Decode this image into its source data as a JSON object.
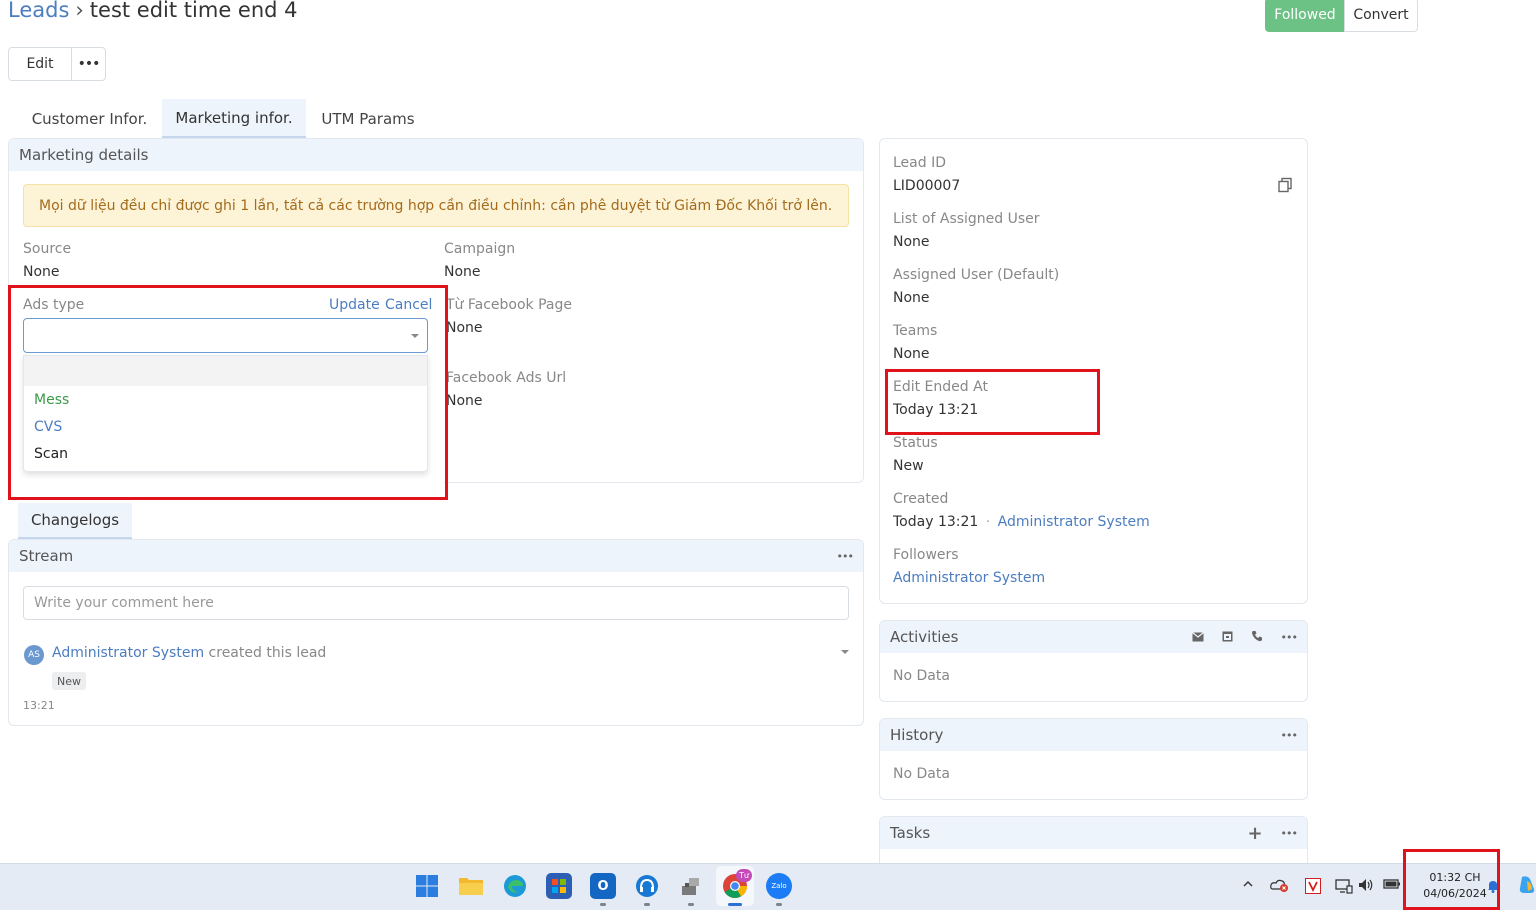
{
  "header": {
    "breadcrumb_root": "Leads",
    "breadcrumb_sep": "›",
    "title": "test edit time end 4",
    "edit_label": "Edit",
    "more_label": "•••",
    "followed_label": "Followed",
    "convert_label": "Convert"
  },
  "tabs": [
    {
      "label": "Customer Infor."
    },
    {
      "label": "Marketing infor."
    },
    {
      "label": "UTM Params"
    }
  ],
  "marketing": {
    "panel_title": "Marketing details",
    "alert": "Mọi dữ liệu đều chỉ được ghi 1 lần, tất cả các trường hợp cần điều chỉnh: cần phê duyệt từ Giám Đốc Khối trở lên.",
    "source_label": "Source",
    "source_value": "None",
    "campaign_label": "Campaign",
    "campaign_value": "None",
    "ads_type_label": "Ads type",
    "update_label": "Update",
    "cancel_label": "Cancel",
    "fb_page_label": "Từ Facebook Page",
    "fb_page_value": "None",
    "fb_ads_url_label": "Facebook Ads Url",
    "fb_ads_url_value": "None",
    "ads_type_options": [
      {
        "label": "Mess",
        "color": "#3b9b4a"
      },
      {
        "label": "CVS",
        "color": "#4c7dc0"
      },
      {
        "label": "Scan",
        "color": "#222222"
      }
    ]
  },
  "changelogs": {
    "tab_label": "Changelogs",
    "stream_title": "Stream",
    "comment_placeholder": "Write your comment here",
    "entry_avatar": "AS",
    "entry_user": "Administrator System",
    "entry_action": "created this lead",
    "entry_badge": "New",
    "entry_time": "13:21"
  },
  "side": {
    "lead_id_label": "Lead ID",
    "lead_id_value": "LID00007",
    "assigned_list_label": "List of Assigned User",
    "assigned_list_value": "None",
    "assigned_default_label": "Assigned User (Default)",
    "assigned_default_value": "None",
    "teams_label": "Teams",
    "teams_value": "None",
    "edit_ended_label": "Edit Ended At",
    "edit_ended_value": "Today 13:21",
    "status_label": "Status",
    "status_value": "New",
    "created_label": "Created",
    "created_value": "Today 13:21",
    "created_dot": "·",
    "created_by": "Administrator System",
    "followers_label": "Followers",
    "followers_value": "Administrator System"
  },
  "activities": {
    "title": "Activities",
    "empty": "No Data"
  },
  "history": {
    "title": "History",
    "empty": "No Data"
  },
  "tasks": {
    "title": "Tasks",
    "add": "+"
  },
  "taskbar": {
    "apps": [
      {
        "name": "windows-start-icon",
        "color": "#2b7de0"
      },
      {
        "name": "file-explorer-icon",
        "color": "#f3b730"
      },
      {
        "name": "edge-browser-icon",
        "color": "#1d9ad6"
      },
      {
        "name": "store-icon",
        "color": "#2c5fb3"
      },
      {
        "name": "outlook-icon",
        "color": "#1367c2"
      },
      {
        "name": "headset-app-icon",
        "color": "#1779d4"
      },
      {
        "name": "tool-app-icon",
        "color": "#7a7a7a"
      },
      {
        "name": "chrome-browser-icon",
        "color": "#db4437"
      },
      {
        "name": "zalo-icon",
        "color": "#1b7cf5"
      }
    ],
    "zalo_text": "Zalo",
    "chrome_badge": "Tư",
    "clock_time": "01:32 CH",
    "clock_date": "04/06/2024"
  }
}
